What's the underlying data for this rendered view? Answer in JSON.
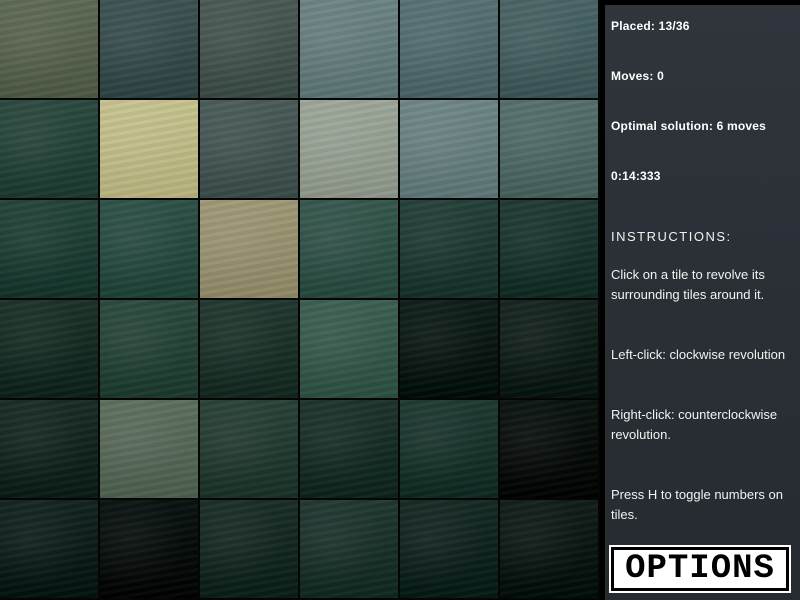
{
  "stats": {
    "placed": "Placed: 13/36",
    "moves": "Moves: 0",
    "optimal": "Optimal solution: 6 moves",
    "timer": "0:14:333"
  },
  "instructions": {
    "title": "INSTRUCTIONS:",
    "line1": "Click on a tile to revolve its surrounding tiles around it.",
    "line2": "Left-click: clockwise revolution",
    "line3": "Right-click: counterclockwise revolution.",
    "line4": "Press H to toggle numbers on tiles."
  },
  "options_button": {
    "label": "OPTIONS"
  },
  "board": {
    "rows": 6,
    "cols": 6,
    "tile_colors": [
      [
        "#5f6a55",
        "#3e5254",
        "#4a5a55",
        "#6d8585",
        "#587274",
        "#4a6566"
      ],
      [
        "#2c4a40",
        "#c8c490",
        "#4a5c5a",
        "#9ea89a",
        "#6f8788",
        "#55706d"
      ],
      [
        "#24443a",
        "#2e5248",
        "#a09a78",
        "#37584e",
        "#25403a",
        "#1f3a34"
      ],
      [
        "#1c3229",
        "#2c4a3e",
        "#22382f",
        "#3d6052",
        "#0f1e19",
        "#16241f"
      ],
      [
        "#192c25",
        "#5e6f5f",
        "#2a4238",
        "#1d342c",
        "#1f3a32",
        "#0b1410"
      ],
      [
        "#142420",
        "#0a1411",
        "#1b2e28",
        "#213831",
        "#172a25",
        "#121e1a"
      ]
    ]
  }
}
